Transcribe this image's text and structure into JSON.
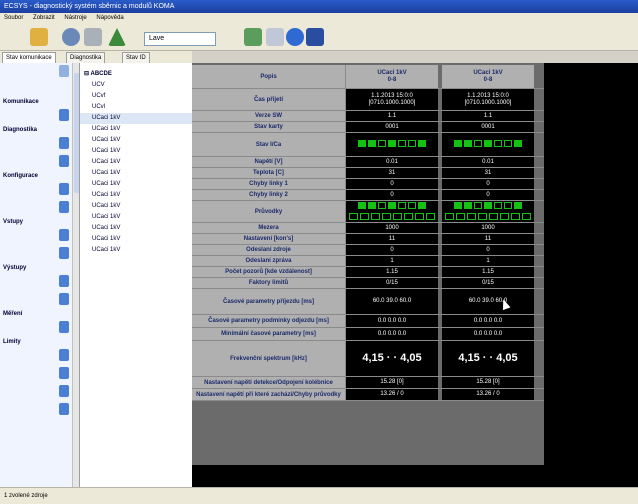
{
  "window": {
    "title": "ECSYS - diagnostický systém sběrnic a modulů KOMA"
  },
  "menu": {
    "items": [
      "Soubor",
      "Zobrazit",
      "Nástroje",
      "Nápověda"
    ]
  },
  "toolbar": {
    "combo_value": "Lave"
  },
  "tabs": [
    "Stav komunikace",
    "Diagnostika",
    "Stav ID"
  ],
  "left_panel": {
    "sections": [
      "Komunikace",
      "Diagnostika",
      "Konfigurace",
      "Vstupy",
      "Výstupy",
      "Měření",
      "Limity"
    ]
  },
  "tree": {
    "root": "ABCDE",
    "items": [
      "UCV",
      "UCvf",
      "UCvl",
      "UCaci 1kV",
      "UCaci 1kV",
      "UCaci 1kV",
      "UCaci 1kV",
      "UCaci 1kV",
      "UCaci 1kV",
      "UCaci 1kV",
      "UCaci 1kV",
      "UCaci 1kV",
      "UCaci 1kV",
      "UCaci 1kV",
      "UCaci 1kV",
      "UCaci 1kV"
    ],
    "selected_index": 3
  },
  "grid": {
    "header_label": "Popis",
    "columns": [
      "UCaci 1kV\n0-8",
      "UCaci 1kV\n0-8"
    ],
    "rows": [
      {
        "label": "Čas přijetí",
        "v1": "1.1.2013 15:0:0\n[0710.1000.1000]",
        "v2": "1.1.2013 15:0:0\n[0710.1000.1000]",
        "h": 22
      },
      {
        "label": "Verze SW",
        "v1": "1.1",
        "v2": "1.1",
        "h": 11
      },
      {
        "label": "Stav karty",
        "v1": "0001",
        "v2": "0001",
        "h": 11
      },
      {
        "label": "Stav I/Ca",
        "v1": "",
        "v2": "",
        "h": 24,
        "type": "ind"
      },
      {
        "label": "Napětí [V]",
        "v1": "0.01",
        "v2": "0.01",
        "h": 11
      },
      {
        "label": "Teplota [C]",
        "v1": "31",
        "v2": "31",
        "h": 11
      },
      {
        "label": "Chyby linky 1",
        "v1": "0",
        "v2": "0",
        "h": 11
      },
      {
        "label": "Chyby linky 2",
        "v1": "0",
        "v2": "0",
        "h": 11
      },
      {
        "label": "Průvodky",
        "v1": "",
        "v2": "",
        "h": 22,
        "type": "ind2"
      },
      {
        "label": "Mezera",
        "v1": "1000",
        "v2": "1000",
        "h": 11
      },
      {
        "label": "Nastavení [kon's]",
        "v1": "11",
        "v2": "11",
        "h": 11
      },
      {
        "label": "Odeslaní zdroje",
        "v1": "0",
        "v2": "0",
        "h": 11
      },
      {
        "label": "Odeslaní zpráva",
        "v1": "1",
        "v2": "1",
        "h": 11
      },
      {
        "label": "Počet pozorů [kde vzdálenost]",
        "v1": "1.15",
        "v2": "1.15",
        "h": 11
      },
      {
        "label": "Faktory limitů",
        "v1": "0/15",
        "v2": "0/15",
        "h": 11
      },
      {
        "label": "Časové parametry příjezdu [ms]",
        "v1": "60.0   39.0   60.0",
        "v2": "60.0   39.0   60.0",
        "h": 26
      },
      {
        "label": "Časové parametry podmínky odjezdu [ms]",
        "v1": "0.0   0.0   0.0",
        "v2": "0.0   0.0   0.0",
        "h": 13
      },
      {
        "label": "Minimální časové parametry [ms]",
        "v1": "0.0   0.0   0.0",
        "v2": "0.0   0.0   0.0",
        "h": 13
      },
      {
        "label": "Frekvenční spektrum [kHz]",
        "v1": "4,15  ·  ·  4,05",
        "v2": "4,15  ·  ·  4,05",
        "h": 36,
        "type": "big"
      },
      {
        "label": "Nastavení napětí detekce/Odpojení kolébnice",
        "v1": "15.28 [0]",
        "v2": "15.28 [0]",
        "h": 12
      },
      {
        "label": "Nastavení napětí při které zachází/Chyby průvodky",
        "v1": "13.26 / 0",
        "v2": "13.26 / 0",
        "h": 12
      }
    ]
  },
  "statusbar": {
    "text": "1 zvolené zdroje"
  }
}
